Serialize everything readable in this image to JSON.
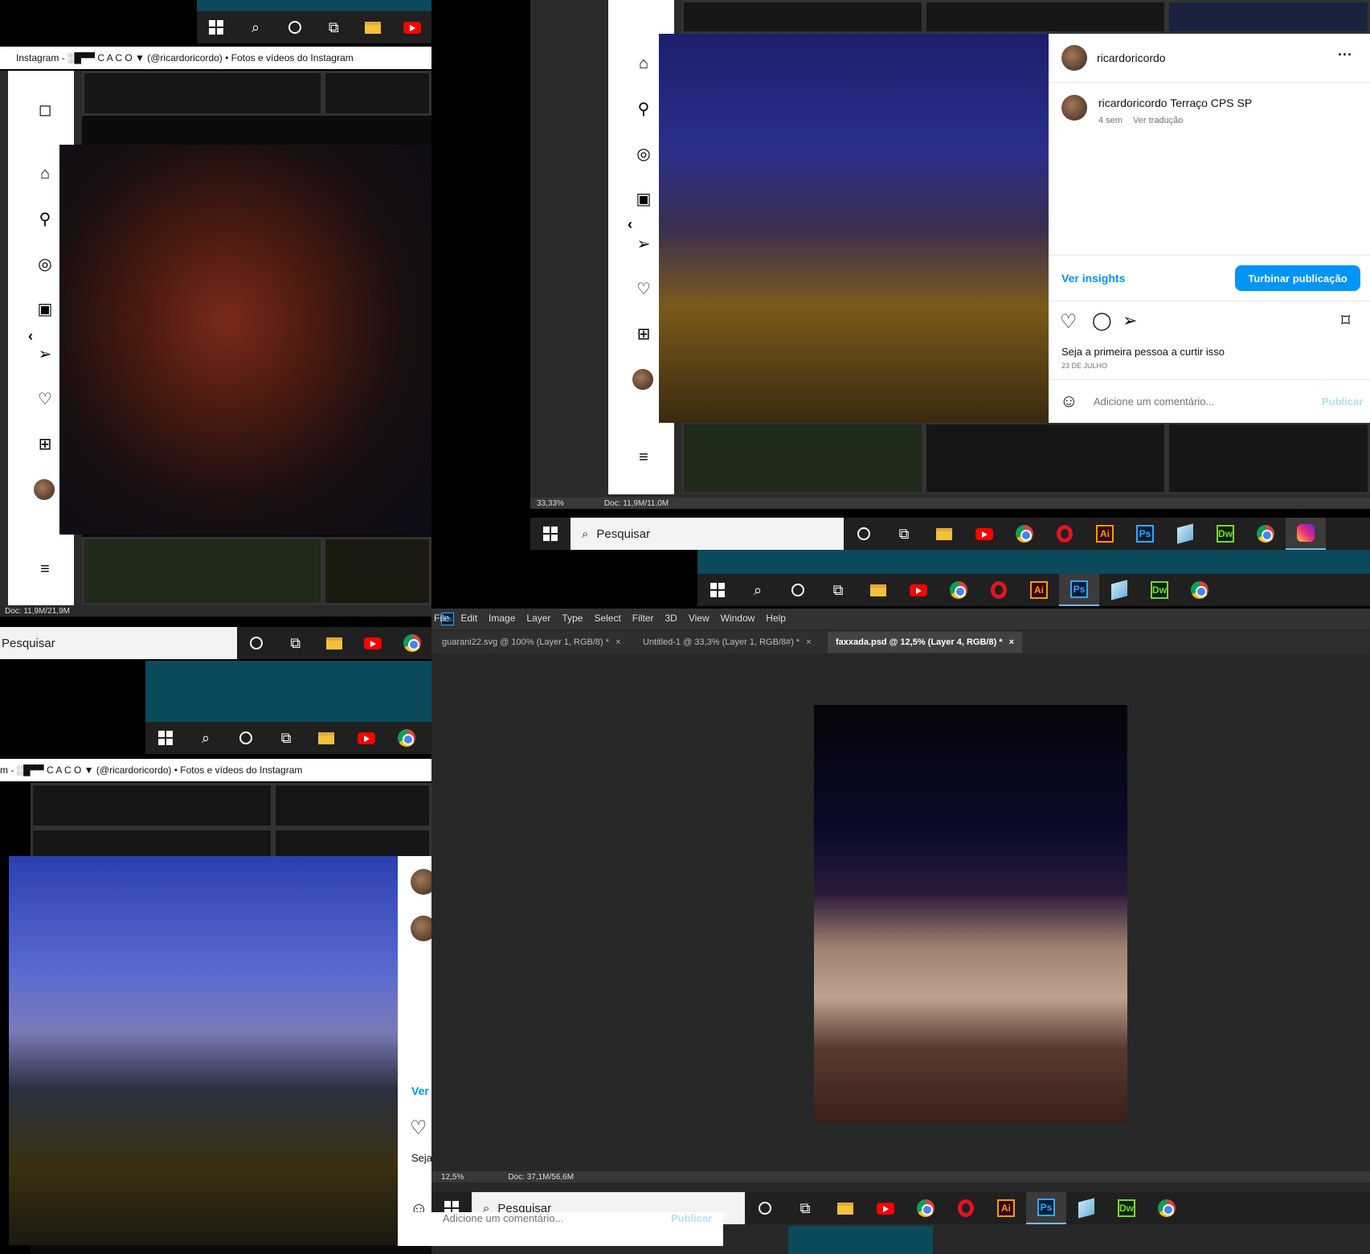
{
  "top_left": {
    "window_title": "Instagram - ░█▀▀ C A C O ▼ (@ricardoricordo) • Fotos e vídeos do Instagram",
    "status": "Doc: 11,9M/21,9M"
  },
  "top_right": {
    "username": "ricardoricordo",
    "caption_user": "ricardoricordo",
    "caption_text": "Terraço CPS SP",
    "time_ago": "4 sem",
    "translate": "Ver tradução",
    "insights": "Ver insights",
    "boost": "Turbinar publicação",
    "likes_text": "Seja a primeira pessoa a curtir isso",
    "date": "23 DE JULHO",
    "comment_placeholder": "Adicione um comentário...",
    "publish": "Publicar",
    "zoom": "33,33%",
    "status": "Doc: 11,9M/11,0M",
    "search_placeholder": "Pesquisar"
  },
  "mid_left": {
    "search_placeholder": "Pesquisar",
    "window_title": "m - ░█▀▀ C A C O ▼ (@ricardoricordo) • Fotos e vídeos do Instagram",
    "insights_partial": "Ver",
    "likes_partial": "Seja",
    "comment_partial": "Adicione um comentário...",
    "publish_partial": "Publicar"
  },
  "photoshop": {
    "menu": [
      "File",
      "Edit",
      "Image",
      "Layer",
      "Type",
      "Select",
      "Filter",
      "3D",
      "View",
      "Window",
      "Help"
    ],
    "tabs": [
      "guarani22.svg @ 100% (Layer 1, RGB/8) *",
      "Untitled-1 @ 33,3% (Layer 1, RGB/8#) *",
      "faxxada.psd @ 12,5% (Layer 4, RGB/8) *"
    ],
    "zoom": "12,5%",
    "status": "Doc: 37,1M/56,6M",
    "search_placeholder": "Pesquisar"
  },
  "colors": {
    "accent": "#0095f6",
    "taskbar_teal": "#0b4a5a",
    "ps_bg": "#282828"
  }
}
